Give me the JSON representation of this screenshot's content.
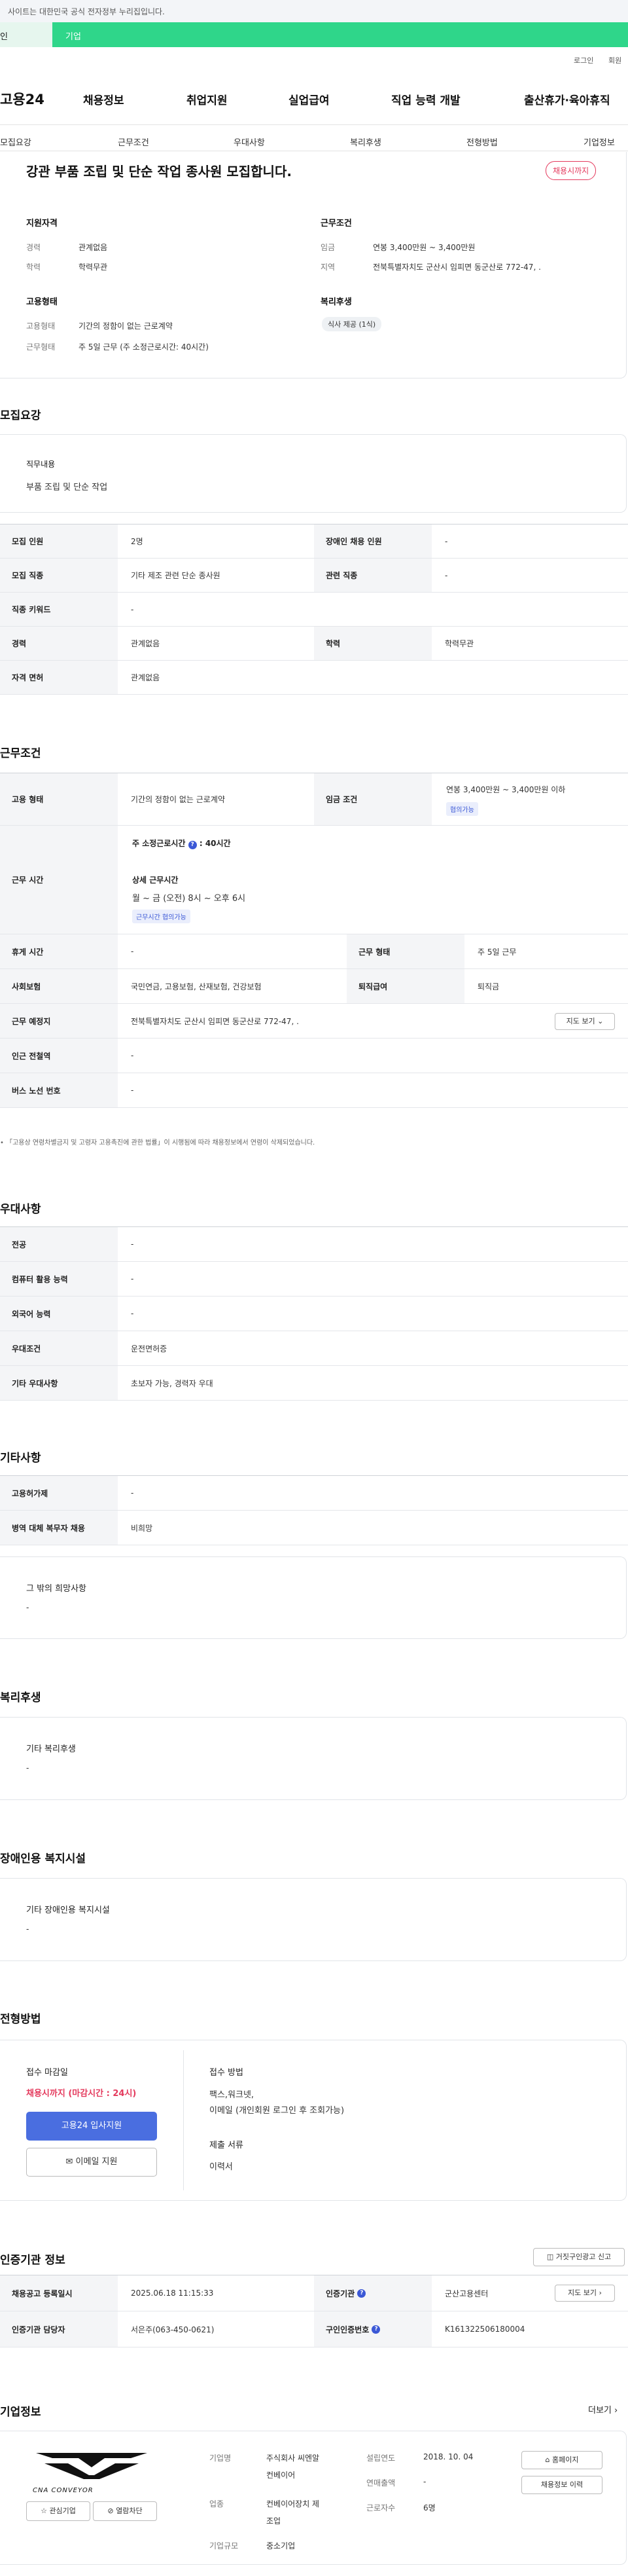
{
  "banner": {
    "text": "사이트는 대한민국 공식 전자정부 누리집입니다."
  },
  "top_tabs": {
    "personal": "인",
    "company": "기업"
  },
  "util": {
    "login": "로그인",
    "join": "회원"
  },
  "header": {
    "logo": "고용24",
    "gnb": [
      "채용정보",
      "취업지원",
      "실업급여",
      "직업 능력 개발",
      "출산휴가·육아휴직"
    ]
  },
  "snb": [
    "모집요강",
    "근무조건",
    "우대사항",
    "복리후생",
    "전형방법",
    "기업정보"
  ],
  "summary": {
    "title": "강관 부품 조립 및 단순 작업 종사원 모집합니다.",
    "badge": "채용시까지",
    "qual_title": "지원자격",
    "career_k": "경력",
    "career_v": "관계없음",
    "edu_k": "학력",
    "edu_v": "학력무관",
    "cond_title": "근무조건",
    "wage_k": "임금",
    "wage_v": "연봉 3,400만원 ~ 3,400만원",
    "loc_k": "지역",
    "loc_v": "전북특별자치도 군산시 임피면 동군산로 772-47, .",
    "emp_title": "고용형태",
    "type_k": "고용형태",
    "type_v": "기간의 정함이 없는 근로계약",
    "form_k": "근무형태",
    "form_v": "주 5일 근무 (주 소정근로시간: 40시간)",
    "welfare_title": "복리후생",
    "welfare_pill": "식사 제공 (1식)"
  },
  "recruit": {
    "section": "모집요강",
    "duty_title": "직무내용",
    "duty_text": "부품 조립 및 단순 작업",
    "rows": [
      {
        "k1": "모집 인원",
        "v1": "2명",
        "k2": "장애인 채용 인원",
        "v2": "-"
      },
      {
        "k1": "모집 직종",
        "v1": "기타 제조 관련 단순 종사원",
        "k2": "관련 직종",
        "v2": "-"
      },
      {
        "k1": "직종 키워드",
        "v1": "-"
      },
      {
        "k1": "경력",
        "v1": "관계없음",
        "k2": "학력",
        "v2": "학력무관"
      },
      {
        "k1": "자격 면허",
        "v1": "관계없음"
      }
    ]
  },
  "work": {
    "section": "근무조건",
    "type_k": "고용 형태",
    "type_v": "기간의 정함이 없는 근로계약",
    "wage_k": "임금 조건",
    "wage_v": "연봉 3,400만원 ~ 3,400만원 이하",
    "wage_tag": "협의가능",
    "hours_k": "근무 시간",
    "hours_std": "주 소정근로시간",
    "hours_std_v": ": 40시간",
    "hours_detail_t": "상세 근무시간",
    "hours_detail_v": "월 ~ 금 (오전) 8시 ~ 오후 6시",
    "hours_tag": "근무시간 협의가능",
    "rest_k": "휴게 시간",
    "rest_v": "-",
    "form_k": "근무 형태",
    "form_v": "주 5일 근무",
    "ins_k": "사회보험",
    "ins_v": "국민연금, 고용보험, 산재보험, 건강보험",
    "ret_k": "퇴직급여",
    "ret_v": "퇴직금",
    "place_k": "근무 예정지",
    "place_v": "전북특별자치도 군산시 임피면 동군산로 772-47, .",
    "map_btn": "지도 보기",
    "subway_k": "인근 전철역",
    "subway_v": "-",
    "bus_k": "버스 노선 번호",
    "bus_v": "-",
    "notice": "「고용상 연령차별금지 및 고령자 고용촉진에 관한 법률」이 시행됨에 따라 채용정보에서 연령이 삭제되었습니다."
  },
  "pref": {
    "section": "우대사항",
    "rows": [
      {
        "k": "전공",
        "v": "-"
      },
      {
        "k": "컴퓨터 활용 능력",
        "v": "-"
      },
      {
        "k": "외국어 능력",
        "v": "-"
      },
      {
        "k": "우대조건",
        "v": "운전면허증"
      },
      {
        "k": "기타 우대사항",
        "v": "초보자 가능, 경력자 우대"
      }
    ]
  },
  "etc": {
    "section": "기타사항",
    "rows": [
      {
        "k": "고용허가제",
        "v": "-"
      },
      {
        "k": "병역 대체 복무자 채용",
        "v": "비희망"
      }
    ],
    "box_title": "그 밖의 희망사항",
    "box_v": "-"
  },
  "welfare": {
    "section": "복리후생",
    "box_title": "기타 복리후생",
    "box_v": "-"
  },
  "disabled": {
    "section": "장애인용 복지시설",
    "box_title": "기타 장애인용 복지시설",
    "box_v": "-"
  },
  "process": {
    "section": "전형방법",
    "deadline_t": "접수 마감일",
    "deadline_v": "채용시까지 (마감시간 : 24시)",
    "apply_btn": "고용24 입사지원",
    "email_btn": "이메일 지원",
    "method_t": "접수 방법",
    "method_v1": "팩스,워크넷,",
    "method_v2": "이메일 (개인회원 로그인 후 조회가능)",
    "doc_t": "제출 서류",
    "doc_v": "이력서"
  },
  "auth": {
    "section": "인증기관 정보",
    "report_btn": "거짓구인광고 신고",
    "reg_k": "채용공고 등록일시",
    "reg_v": "2025.06.18 11:15:33",
    "org_k": "인증기관",
    "org_v": "군산고용센터",
    "map_btn": "지도 보기",
    "mgr_k": "인증기관 담당자",
    "mgr_v": "서은주(063-450-0621)",
    "no_k": "구인인증번호",
    "no_v": "K161322506180004"
  },
  "company": {
    "section": "기업정보",
    "more": "더보기",
    "logo_text": "CNA CONVEYOR",
    "fav_btn": "관심기업",
    "block_btn": "열람차단",
    "name_k": "기업명",
    "name_v1": "주식회사 씨엔알",
    "name_v2": "컨베이어",
    "industry_k": "업종",
    "industry_v1": "컨베이어장치 제",
    "industry_v2": "조업",
    "size_k": "기업규모",
    "size_v": "중소기업",
    "est_k": "설립연도",
    "est_v": "2018. 10. 04",
    "sales_k": "연매출액",
    "sales_v": "-",
    "emp_k": "근로자수",
    "emp_v": "6명",
    "home_btn": "홈페이지",
    "hist_btn": "채용정보 이력"
  },
  "colors": {
    "accent": "#4a6ee0",
    "green": "#2fd68a",
    "red": "#e43a5d"
  }
}
